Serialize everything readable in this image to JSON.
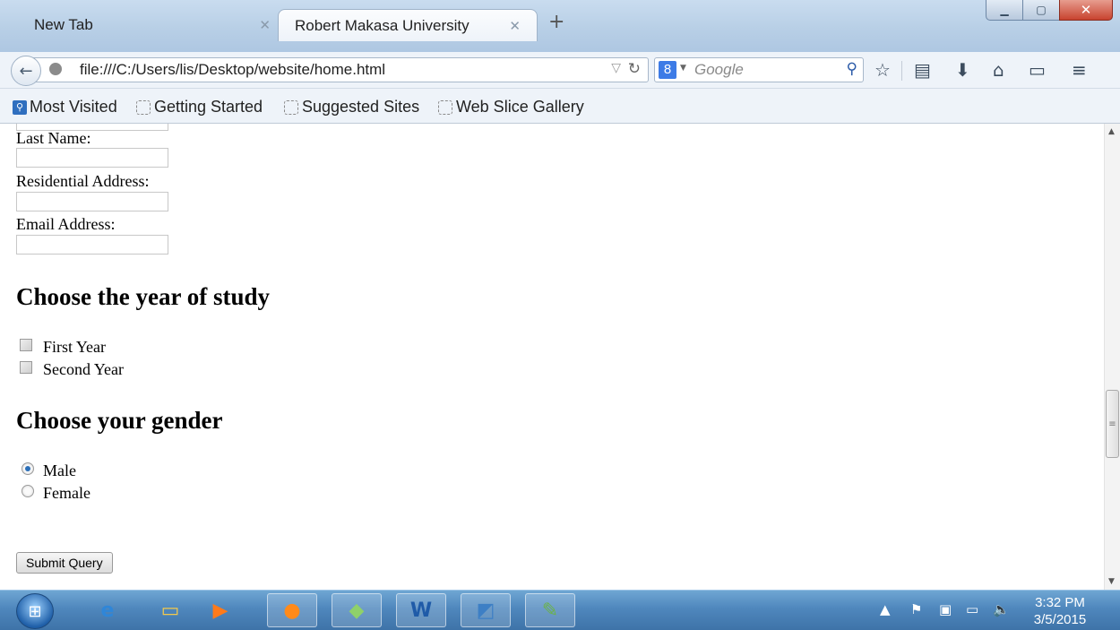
{
  "browser": {
    "tabs": [
      {
        "label": "New Tab"
      },
      {
        "label": "Robert Makasa University"
      }
    ],
    "url": "file:///C:/Users/lis/Desktop/website/home.html",
    "search_placeholder": "Google",
    "search_engine_badge": "8"
  },
  "bookmarks": [
    {
      "label": "Most Visited"
    },
    {
      "label": "Getting Started"
    },
    {
      "label": "Suggested Sites"
    },
    {
      "label": "Web Slice Gallery"
    }
  ],
  "form": {
    "last_name_label": "Last Name:",
    "address_label": "Residential Address:",
    "email_label": "Email Address:",
    "year_heading": "Choose the year of study",
    "year_options": [
      {
        "label": "First Year",
        "checked": false
      },
      {
        "label": "Second Year",
        "checked": false
      }
    ],
    "gender_heading": "Choose your gender",
    "gender_options": [
      {
        "label": "Male",
        "checked": true
      },
      {
        "label": "Female",
        "checked": false
      }
    ],
    "submit_label": "Submit Query"
  },
  "taskbar": {
    "time": "3:32 PM",
    "date": "3/5/2015"
  },
  "colors": {
    "taskbar": "#4f87bd",
    "chrome": "#eef3f9",
    "radio_accent": "#2c6fb8"
  }
}
